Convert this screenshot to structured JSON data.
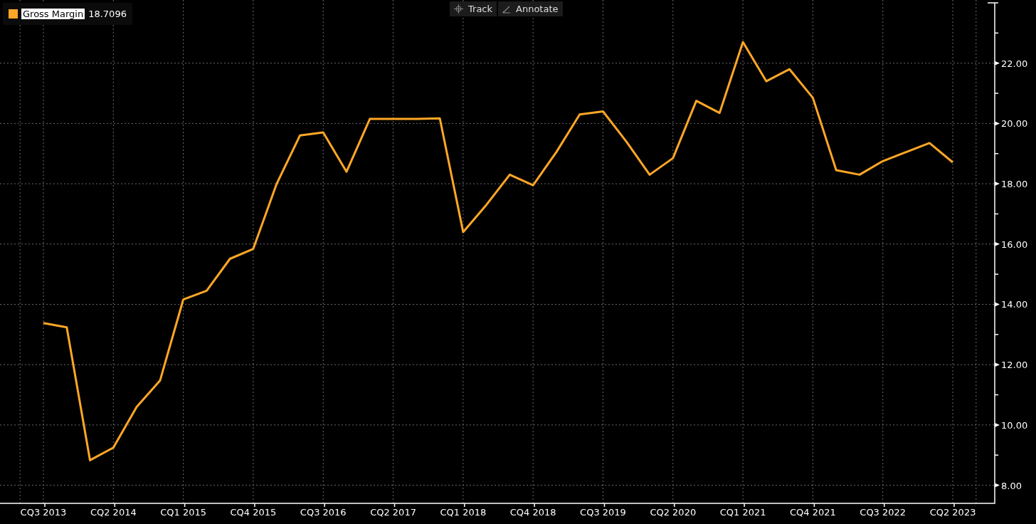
{
  "legend": {
    "value": "18.7096",
    "highlighted": true
  },
  "toolbar": [
    {
      "label": "Track",
      "kind": "track"
    },
    {
      "label": "Annotate",
      "kind": "annotate"
    }
  ],
  "chart_data": {
    "type": "line",
    "grid": true,
    "categories": [
      "CQ3 2013",
      null,
      null,
      "CQ2 2014",
      null,
      null,
      "CQ1 2015",
      null,
      null,
      "CQ4 2015",
      null,
      null,
      "CQ3 2016",
      null,
      null,
      "CQ2 2017",
      null,
      null,
      "CQ1 2018",
      null,
      null,
      "CQ4 2018",
      null,
      null,
      "CQ3 2019",
      null,
      null,
      "CQ2 2020",
      null,
      null,
      "CQ1 2021",
      null,
      null,
      "CQ4 2021",
      null,
      null,
      "CQ3 2022",
      null,
      null,
      "CQ2 2023"
    ],
    "series": [
      {
        "name": "Gross Margin",
        "color": "#ffa726",
        "values": [
          13.38,
          13.24,
          8.83,
          9.25,
          10.6,
          11.47,
          14.16,
          14.45,
          15.51,
          15.84,
          17.99,
          19.6,
          19.7,
          18.4,
          20.15,
          20.15,
          20.15,
          20.17,
          16.4,
          17.3,
          18.3,
          17.95,
          19.05,
          20.3,
          20.4,
          19.4,
          18.3,
          18.85,
          20.75,
          20.35,
          22.7,
          21.4,
          21.8,
          20.85,
          18.45,
          18.3,
          18.75,
          19.05,
          19.35,
          18.71
        ]
      }
    ],
    "ylim": [
      7.4,
      24
    ],
    "yticks": [
      {
        "value": 8,
        "label": "8.00"
      },
      {
        "value": 10,
        "label": "10.00"
      },
      {
        "value": 12,
        "label": "12.00"
      },
      {
        "value": 14,
        "label": "14.00"
      },
      {
        "value": 16,
        "label": "16.00"
      },
      {
        "value": 18,
        "label": "18.00"
      },
      {
        "value": 20,
        "label": "20.00"
      },
      {
        "value": 22,
        "label": "22.00"
      }
    ]
  }
}
